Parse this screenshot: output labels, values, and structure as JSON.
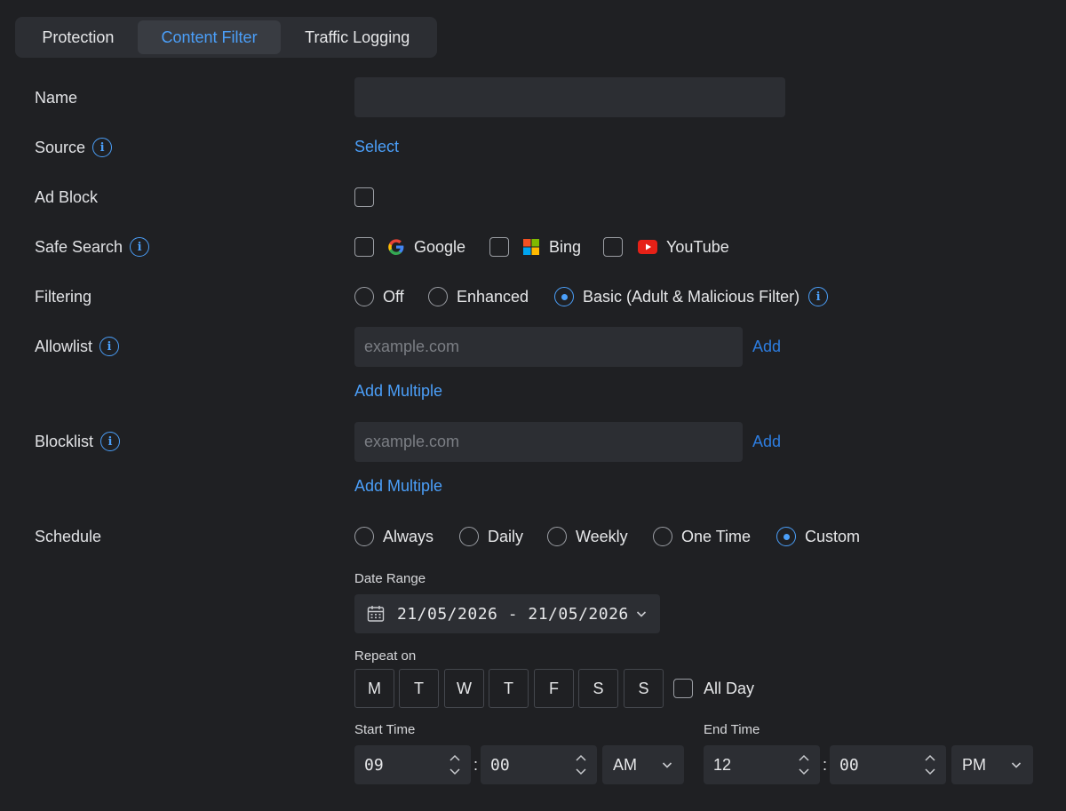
{
  "tabs": [
    "Protection",
    "Content Filter",
    "Traffic Logging"
  ],
  "active_tab": "Content Filter",
  "labels": {
    "name": "Name",
    "source": "Source",
    "ad_block": "Ad Block",
    "safe_search": "Safe Search",
    "filtering": "Filtering",
    "allowlist": "Allowlist",
    "blocklist": "Blocklist",
    "schedule": "Schedule"
  },
  "name_value": "",
  "source_link": "Select",
  "ad_block_checked": false,
  "safe_search": [
    {
      "label": "Google",
      "icon": "google-icon",
      "checked": false
    },
    {
      "label": "Bing",
      "icon": "bing-icon",
      "checked": false
    },
    {
      "label": "YouTube",
      "icon": "youtube-icon",
      "checked": false
    }
  ],
  "filtering": {
    "options": [
      "Off",
      "Enhanced",
      "Basic (Adult & Malicious Filter)"
    ],
    "selected": "Basic (Adult & Malicious Filter)"
  },
  "allowlist": {
    "placeholder": "example.com",
    "add": "Add",
    "add_multiple": "Add Multiple"
  },
  "blocklist": {
    "placeholder": "example.com",
    "add": "Add",
    "add_multiple": "Add Multiple"
  },
  "schedule": {
    "options": [
      "Always",
      "Daily",
      "Weekly",
      "One Time",
      "Custom"
    ],
    "selected": "Custom",
    "date_range_label": "Date Range",
    "date_range_value": "21/05/2026 - 21/05/2026",
    "repeat_on_label": "Repeat on",
    "days": [
      "M",
      "T",
      "W",
      "T",
      "F",
      "S",
      "S"
    ],
    "all_day_label": "All Day",
    "all_day_checked": false,
    "start_time_label": "Start Time",
    "start_hour": "09",
    "start_minute": "00",
    "start_period": "AM",
    "end_time_label": "End Time",
    "end_hour": "12",
    "end_minute": "00",
    "end_period": "PM",
    "colon": ":"
  },
  "colors": {
    "background": "#1f2023",
    "accent": "#4b9ff9",
    "field": "#2c2e33"
  }
}
